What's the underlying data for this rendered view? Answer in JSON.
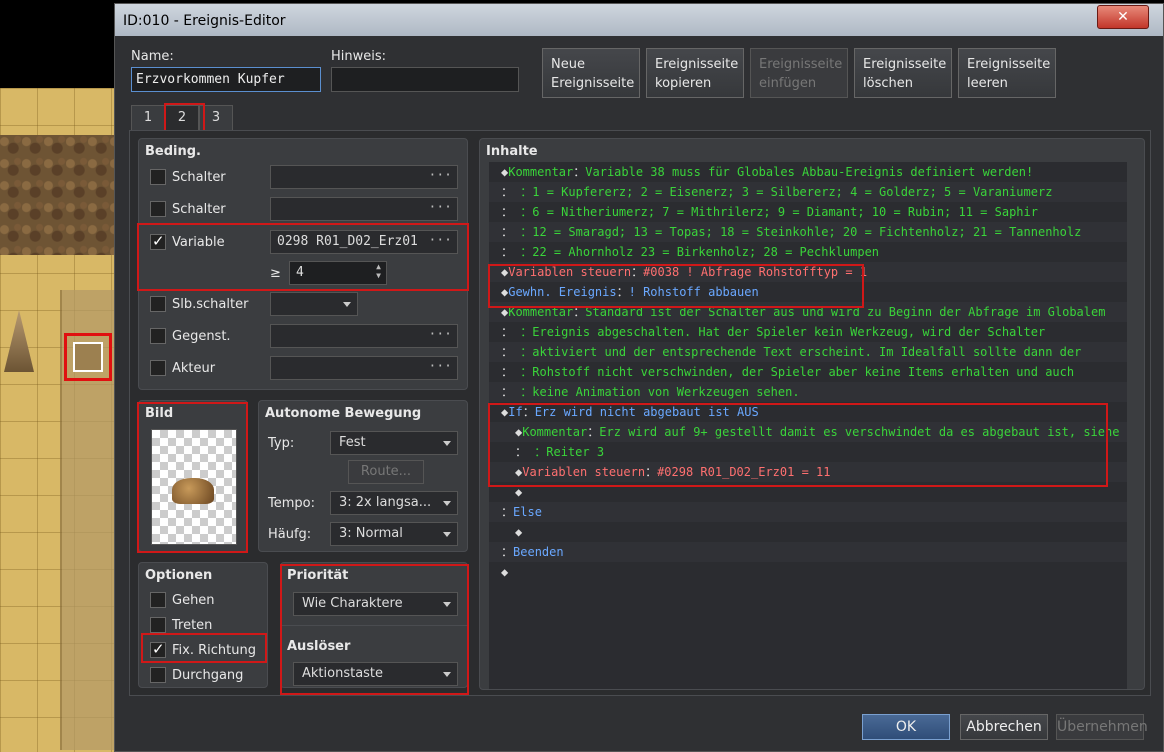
{
  "window": {
    "title": "ID:010 - Ereignis-Editor",
    "close": "✕"
  },
  "name": {
    "label": "Name:",
    "value": "Erzvorkommen Kupfer"
  },
  "hint": {
    "label": "Hinweis:",
    "value": ""
  },
  "page_buttons": [
    {
      "line1": "Neue",
      "line2": "Ereignisseite"
    },
    {
      "line1": "Ereignisseite",
      "line2": "kopieren"
    },
    {
      "line1": "Ereignisseite",
      "line2": "einfügen"
    },
    {
      "line1": "Ereignisseite",
      "line2": "löschen"
    },
    {
      "line1": "Ereignisseite",
      "line2": "leeren"
    }
  ],
  "tabs": [
    "1",
    "2",
    "3"
  ],
  "conditions": {
    "title": "Beding.",
    "switch1": "Schalter",
    "switch2": "Schalter",
    "variable": "Variable",
    "variable_value": "0298 R01_D02_Erz01",
    "geq": "≥",
    "number": "4",
    "self_switch": "Slb.schalter",
    "item": "Gegenst.",
    "actor": "Akteur",
    "dots": "···"
  },
  "image": {
    "title": "Bild"
  },
  "autonomous": {
    "title": "Autonome Bewegung",
    "type_label": "Typ:",
    "type_value": "Fest",
    "route": "Route...",
    "speed_label": "Tempo:",
    "speed_value": "3: 2x langsa...",
    "freq_label": "Häufg:",
    "freq_value": "3: Normal"
  },
  "options": {
    "title": "Optionen",
    "walk": "Gehen",
    "step": "Treten",
    "fixdir": "Fix. Richtung",
    "through": "Durchgang"
  },
  "priority": {
    "title": "Priorität",
    "value": "Wie Charaktere"
  },
  "trigger": {
    "title": "Auslöser",
    "value": "Aktionstaste"
  },
  "contents": {
    "title": "Inhalte"
  },
  "buttons": {
    "ok": "OK",
    "cancel": "Abbrechen",
    "apply": "Übernehmen"
  },
  "colors": {
    "comment": "#3ad43a",
    "variable": "#ff7070",
    "flow": "#6aa8ff",
    "accent": "#d01818"
  },
  "lines": [
    {
      "indent": 0,
      "parts": [
        [
          "d",
          "◆"
        ],
        [
          "g",
          "Kommentar"
        ],
        [
          "d",
          "："
        ],
        [
          "g",
          "Variable 38 muss für Globales Abbau-Ereignis definiert werden!"
        ]
      ]
    },
    {
      "indent": 0,
      "parts": [
        [
          "d",
          "："
        ],
        [
          "g",
          "           ：1 = Kupfererz; 2 = Eisenerz; 3 = Silbererz; 4 = Golderz; 5 = Varaniumerz"
        ]
      ]
    },
    {
      "indent": 0,
      "parts": [
        [
          "d",
          "："
        ],
        [
          "g",
          "           ：6 = Nitheriumerz; 7 = Mithrilerz; 9 = Diamant; 10 = Rubin; 11 = Saphir"
        ]
      ]
    },
    {
      "indent": 0,
      "parts": [
        [
          "d",
          "："
        ],
        [
          "g",
          "           ：12 = Smaragd; 13 = Topas; 18 = Steinkohle; 20 = Fichtenholz; 21 = Tannenholz"
        ]
      ]
    },
    {
      "indent": 0,
      "parts": [
        [
          "d",
          "："
        ],
        [
          "g",
          "           ：22 = Ahornholz 23 = Birkenholz; 28 = Pechklumpen"
        ]
      ]
    },
    {
      "indent": 0,
      "parts": [
        [
          "d",
          "◆"
        ],
        [
          "r",
          "Variablen steuern"
        ],
        [
          "d",
          "："
        ],
        [
          "r",
          "#0038 ! Abfrage Rohstofftyp = 1"
        ]
      ]
    },
    {
      "indent": 0,
      "parts": [
        [
          "d",
          "◆"
        ],
        [
          "b",
          "Gewhn. Ereignis"
        ],
        [
          "d",
          "："
        ],
        [
          "b",
          "! Rohstoff abbauen"
        ]
      ]
    },
    {
      "indent": 0,
      "parts": [
        [
          "d",
          "◆"
        ],
        [
          "g",
          "Kommentar"
        ],
        [
          "d",
          "："
        ],
        [
          "g",
          "Standard ist der Schalter aus und wird zu Beginn der Abfrage im Globalem"
        ]
      ]
    },
    {
      "indent": 0,
      "parts": [
        [
          "d",
          "："
        ],
        [
          "g",
          "           ：Ereignis abgeschalten. Hat der Spieler kein Werkzeug, wird der Schalter"
        ]
      ]
    },
    {
      "indent": 0,
      "parts": [
        [
          "d",
          "："
        ],
        [
          "g",
          "           ：aktiviert und der entsprechende Text erscheint. Im Idealfall sollte dann der"
        ]
      ]
    },
    {
      "indent": 0,
      "parts": [
        [
          "d",
          "："
        ],
        [
          "g",
          "           ：Rohstoff nicht verschwinden, der Spieler aber keine Items erhalten und auch"
        ]
      ]
    },
    {
      "indent": 0,
      "parts": [
        [
          "d",
          "："
        ],
        [
          "g",
          "           ：keine Animation von Werkzeugen sehen."
        ]
      ]
    },
    {
      "indent": 0,
      "parts": [
        [
          "d",
          "◆"
        ],
        [
          "b",
          "If"
        ],
        [
          "d",
          "："
        ],
        [
          "b",
          "Erz wird nicht abgebaut ist AUS"
        ]
      ]
    },
    {
      "indent": 1,
      "parts": [
        [
          "d",
          "◆"
        ],
        [
          "g",
          "Kommentar"
        ],
        [
          "d",
          "："
        ],
        [
          "g",
          "Erz wird auf 9+ gestellt damit es verschwindet da es abgebaut ist, siehe"
        ]
      ]
    },
    {
      "indent": 1,
      "parts": [
        [
          "d",
          "："
        ],
        [
          "g",
          "         ：Reiter 3"
        ]
      ]
    },
    {
      "indent": 1,
      "parts": [
        [
          "d",
          "◆"
        ],
        [
          "r",
          "Variablen steuern"
        ],
        [
          "d",
          "："
        ],
        [
          "r",
          "#0298 R01_D02_Erz01 = 11"
        ]
      ]
    },
    {
      "indent": 1,
      "parts": [
        [
          "d",
          "◆"
        ]
      ]
    },
    {
      "indent": 0,
      "parts": [
        [
          "d",
          "："
        ],
        [
          "b",
          "Else"
        ]
      ]
    },
    {
      "indent": 1,
      "parts": [
        [
          "d",
          "◆"
        ]
      ]
    },
    {
      "indent": 0,
      "parts": [
        [
          "d",
          "："
        ],
        [
          "b",
          "Beenden"
        ]
      ]
    },
    {
      "indent": 0,
      "parts": [
        [
          "d",
          "◆"
        ]
      ]
    }
  ]
}
